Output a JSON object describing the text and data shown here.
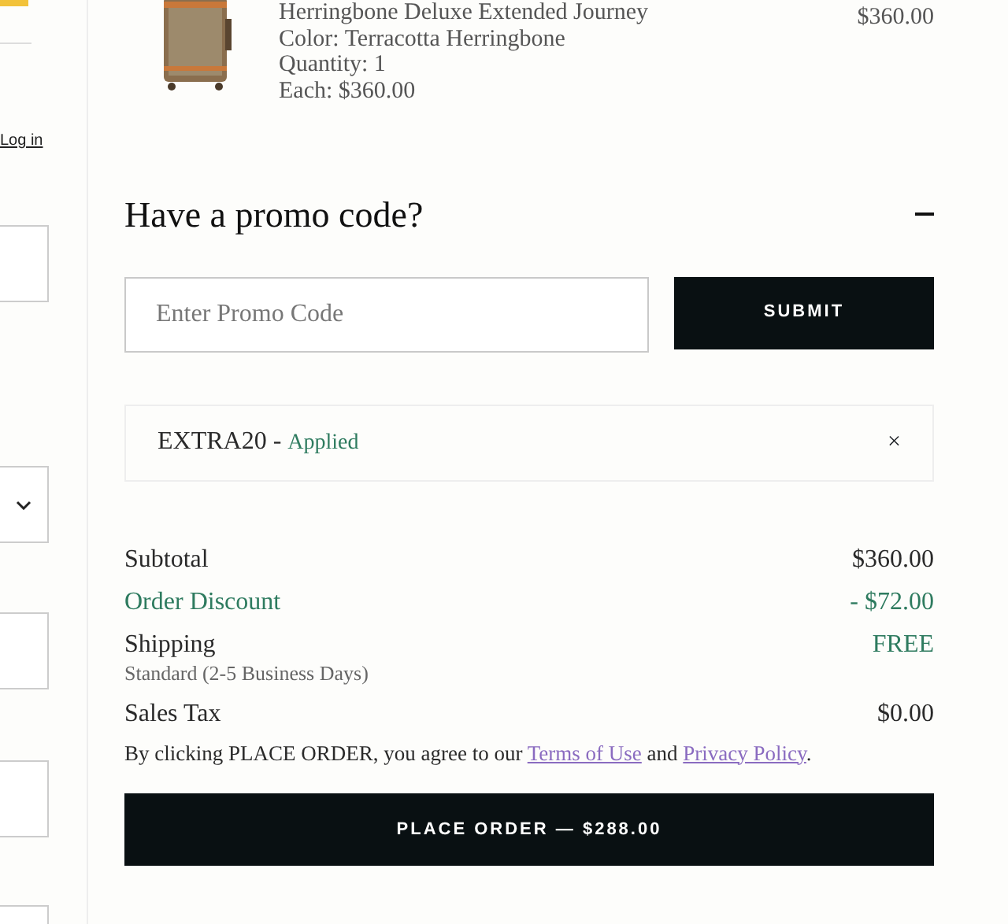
{
  "sidebar": {
    "login_link": "Log in",
    "fields": [
      {
        "kind": "text"
      },
      {
        "kind": "select"
      },
      {
        "kind": "text"
      },
      {
        "kind": "text"
      },
      {
        "kind": "text"
      }
    ]
  },
  "cart_item": {
    "name": "Herringbone Deluxe Extended Journey",
    "details": [
      "Color: Terracotta Herringbone",
      "Quantity: 1",
      "Each: $360.00"
    ],
    "price": "$360.00"
  },
  "promo": {
    "title": "Have a promo code?",
    "expanded": true,
    "placeholder": "Enter Promo Code",
    "submit": "SUBMIT",
    "applied": {
      "code": "EXTRA20 - ",
      "status": "Applied",
      "remove": "×"
    }
  },
  "summary": [
    {
      "label": "Subtotal",
      "value": "$360.00",
      "kind": "normal"
    },
    {
      "label": "Order Discount",
      "value": "- $72.00",
      "kind": "discount"
    },
    {
      "label": "Shipping",
      "value": "FREE",
      "kind": "free",
      "note": "Standard (2-5 Business Days)"
    },
    {
      "label": "Sales Tax",
      "value": "$0.00",
      "kind": "normal"
    }
  ],
  "agreement": {
    "text": "By clicking PLACE ORDER, you agree to our ",
    "links": [
      "Terms of Use",
      "Privacy Policy"
    ],
    "joiner": " and ",
    "end": "."
  },
  "place_order": "PLACE ORDER — $288.00"
}
